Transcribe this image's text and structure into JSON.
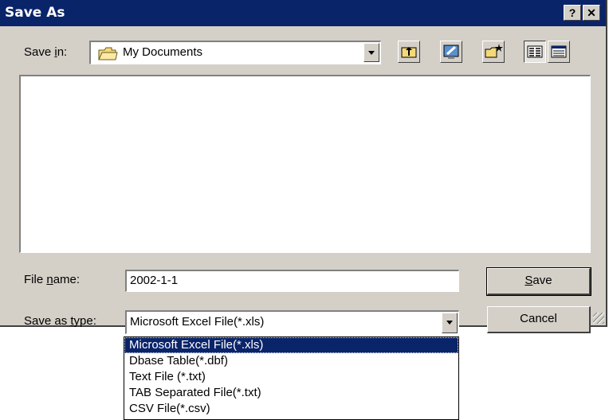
{
  "window": {
    "title": "Save As",
    "help_label": "?",
    "close_label": "✕"
  },
  "save_in": {
    "label_pre": "Save ",
    "label_key": "i",
    "label_post": "n:",
    "value": "My Documents"
  },
  "toolbar": {
    "buttons": [
      "up-one-level-icon",
      "desktop-icon",
      "new-folder-icon",
      "list-view-icon",
      "details-view-icon"
    ],
    "pressed": "list-view-icon"
  },
  "file_name": {
    "label_pre": "File ",
    "label_key": "n",
    "label_post": "ame:",
    "value": "2002-1-1"
  },
  "save_type": {
    "label_pre": "Save as ",
    "label_key": "t",
    "label_post": "ype:",
    "value": "Microsoft Excel File(*.xls)",
    "options": [
      "Microsoft Excel File(*.xls)",
      "Dbase Table(*.dbf)",
      "Text File (*.txt)",
      "TAB Separated File(*.txt)",
      "CSV File(*.csv)"
    ],
    "selected_index": 0
  },
  "buttons": {
    "save_key": "S",
    "save_rest": "ave",
    "cancel": "Cancel"
  },
  "colors": {
    "title_bar": "#0a246a",
    "face": "#d4d0c8",
    "selection": "#0a246a"
  }
}
